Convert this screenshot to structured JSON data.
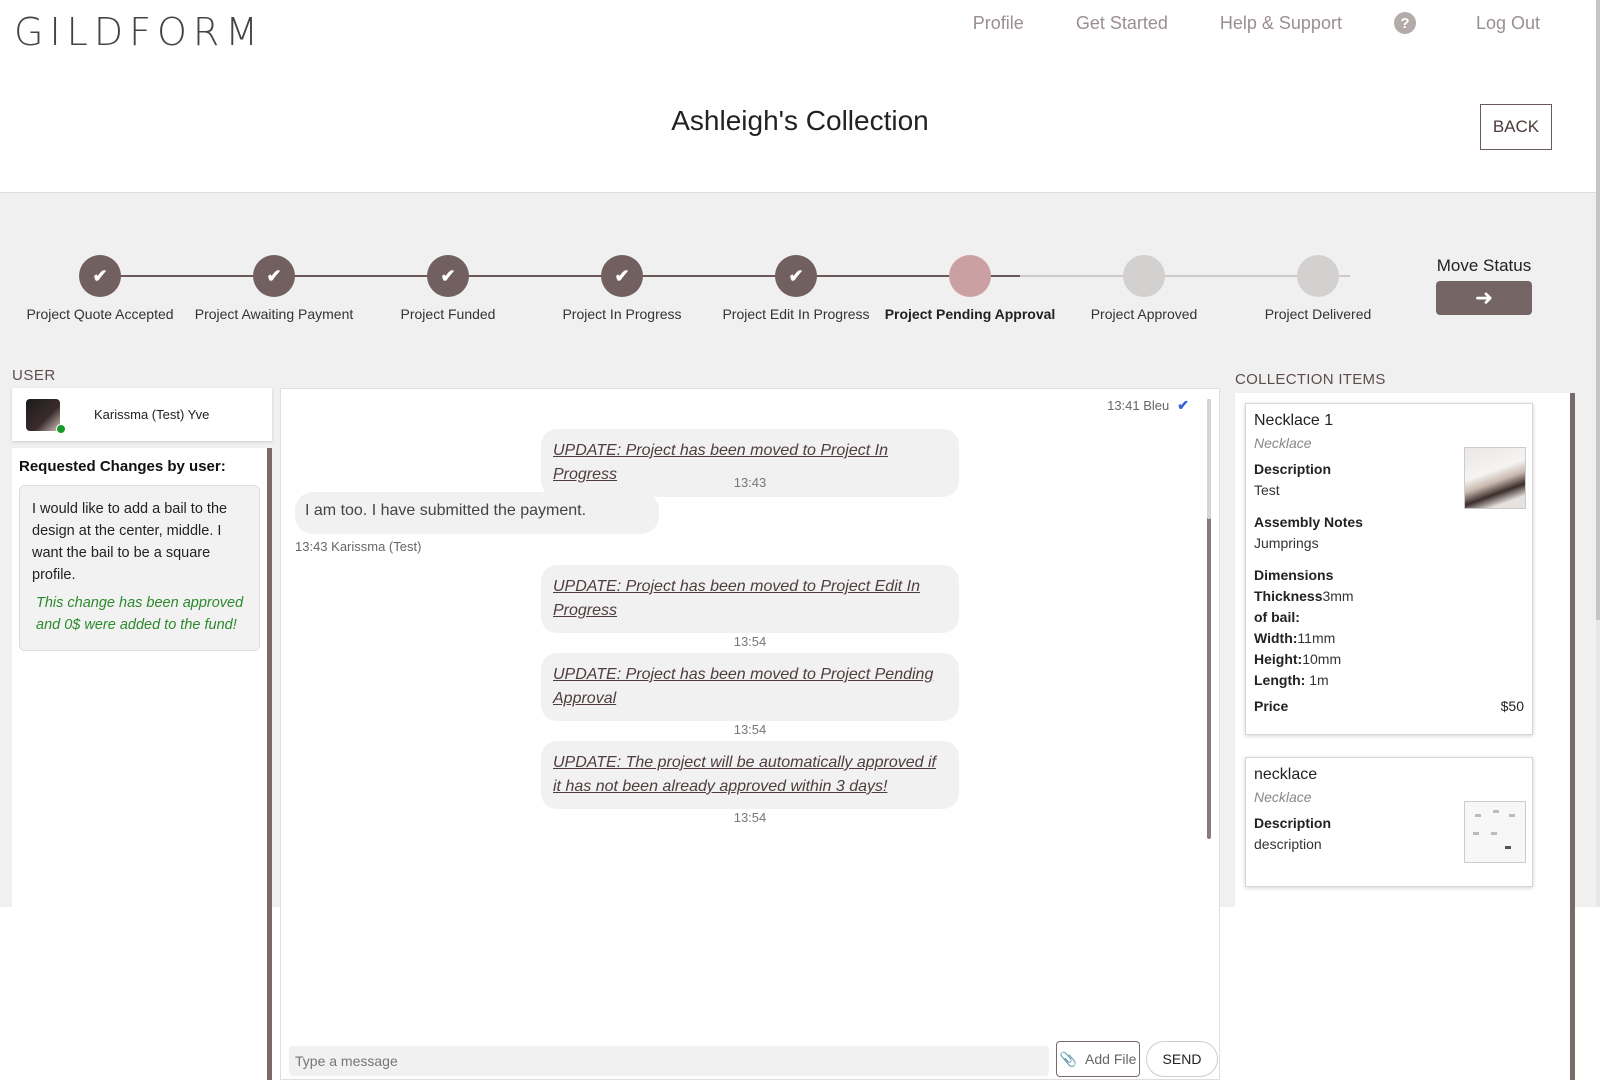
{
  "header": {
    "logo": "GILDFORM",
    "nav": [
      {
        "label": "Profile"
      },
      {
        "label": "Get Started"
      },
      {
        "label": "Help & Support"
      },
      {
        "label": "Log Out"
      }
    ],
    "title": "Ashleigh's Collection",
    "back_label": "BACK"
  },
  "steps": [
    {
      "label": "Project Quote Accepted",
      "state": "done"
    },
    {
      "label": "Project Awaiting Payment",
      "state": "done"
    },
    {
      "label": "Project Funded",
      "state": "done"
    },
    {
      "label": "Project In Progress",
      "state": "done"
    },
    {
      "label": "Project Edit In Progress",
      "state": "done"
    },
    {
      "label": "Project Pending Approval",
      "state": "current"
    },
    {
      "label": "Project Approved",
      "state": "todo"
    },
    {
      "label": "Project Delivered",
      "state": "todo"
    }
  ],
  "move_status": {
    "label": "Move Status",
    "icon": "arrow-right-icon"
  },
  "user": {
    "heading": "USER",
    "name": "Karissma (Test) Yve",
    "online": true,
    "changes_title": "Requested Changes by user:",
    "change_text": "I would like to add a bail to the design at the center, middle. I want the bail to be a square profile.",
    "change_note": "This change has been approved and 0$ were added to the fund!"
  },
  "chat": {
    "top_meta": "13:41 Bleu",
    "messages": [
      {
        "text": "UPDATE: Project has been moved to Project In Progress",
        "time": "13:43"
      },
      {
        "text": "UPDATE: Project has been moved to Project Edit In Progress",
        "time": "13:54"
      },
      {
        "text": "UPDATE: Project has been moved to Project Pending Approval",
        "time": "13:54"
      },
      {
        "text": "UPDATE: The project will be automatically approved if it has not been already approved within 3 days!",
        "time": "13:54"
      }
    ],
    "user_message": "I am too. I have submitted the payment.",
    "user_meta": "13:43 Karissma (Test)",
    "input_placeholder": "Type a message",
    "add_file_label": "Add File",
    "send_label": "SEND"
  },
  "collection": {
    "heading": "COLLECTION ITEMS",
    "items": [
      {
        "title": "Necklace 1",
        "type": "Necklace",
        "description_label": "Description",
        "description": "Test",
        "notes_label": "Assembly Notes",
        "notes": "Jumprings",
        "dimensions_label": "Dimensions",
        "thickness_label": "Thickness",
        "thickness": "3mm",
        "of_bail": "of bail:",
        "width_label": "Width:",
        "width": "11mm",
        "height_label": "Height:",
        "height": "10mm",
        "length_label": "Length:",
        "length": " 1m",
        "price_label": "Price",
        "price": "$50"
      },
      {
        "title": "necklace",
        "type": "Necklace",
        "description_label": "Description",
        "description": "description"
      }
    ]
  },
  "colors": {
    "accent": "#725f5f",
    "current_step": "#caa0a3",
    "pending_step": "#d3d0d0",
    "approved_note": "#2c8a2c",
    "read_check": "#2f63d6"
  }
}
